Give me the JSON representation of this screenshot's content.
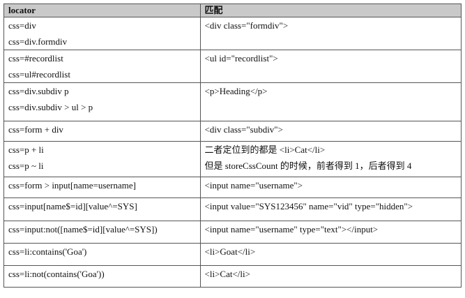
{
  "table": {
    "headers": [
      "locator",
      "匹配"
    ],
    "rows": [
      {
        "locator": [
          "css=div",
          "css=div.formdiv"
        ],
        "match": [
          "<div class=\"formdiv\">"
        ]
      },
      {
        "locator": [
          "css=#recordlist",
          "css=ul#recordlist"
        ],
        "match": [
          "<ul id=\"recordlist\">"
        ]
      },
      {
        "locator": [
          "css=div.subdiv p",
          "css=div.subdiv > ul > p"
        ],
        "match": [
          "<p>Heading</p>"
        ]
      },
      {
        "locator": [
          "css=form + div"
        ],
        "match": [
          "<div class=\"subdiv\">"
        ]
      },
      {
        "locator": [
          "css=p + li",
          "css=p ~ li"
        ],
        "match": [
          "二者定位到的都是 <li>Cat</li>",
          "但是 storeCssCount 的时候，前者得到 1，后者得到 4"
        ]
      },
      {
        "locator": [
          "css=form > input[name=username]"
        ],
        "match": [
          "<input name=\"username\">"
        ]
      },
      {
        "locator": [
          "css=input[name$=id][value^=SYS]"
        ],
        "match": [
          "<input value=\"SYS123456\" name=\"vid\" type=\"hidden\">"
        ]
      },
      {
        "locator": [
          "css=input:not([name$=id][value^=SYS])"
        ],
        "match": [
          "<input name=\"username\" type=\"text\"></input>"
        ]
      },
      {
        "locator": [
          "css=li:contains('Goa')"
        ],
        "match": [
          "<li>Goat</li>"
        ]
      },
      {
        "locator": [
          "css=li:not(contains('Goa'))"
        ],
        "match": [
          "<li>Cat</li>"
        ]
      }
    ]
  }
}
